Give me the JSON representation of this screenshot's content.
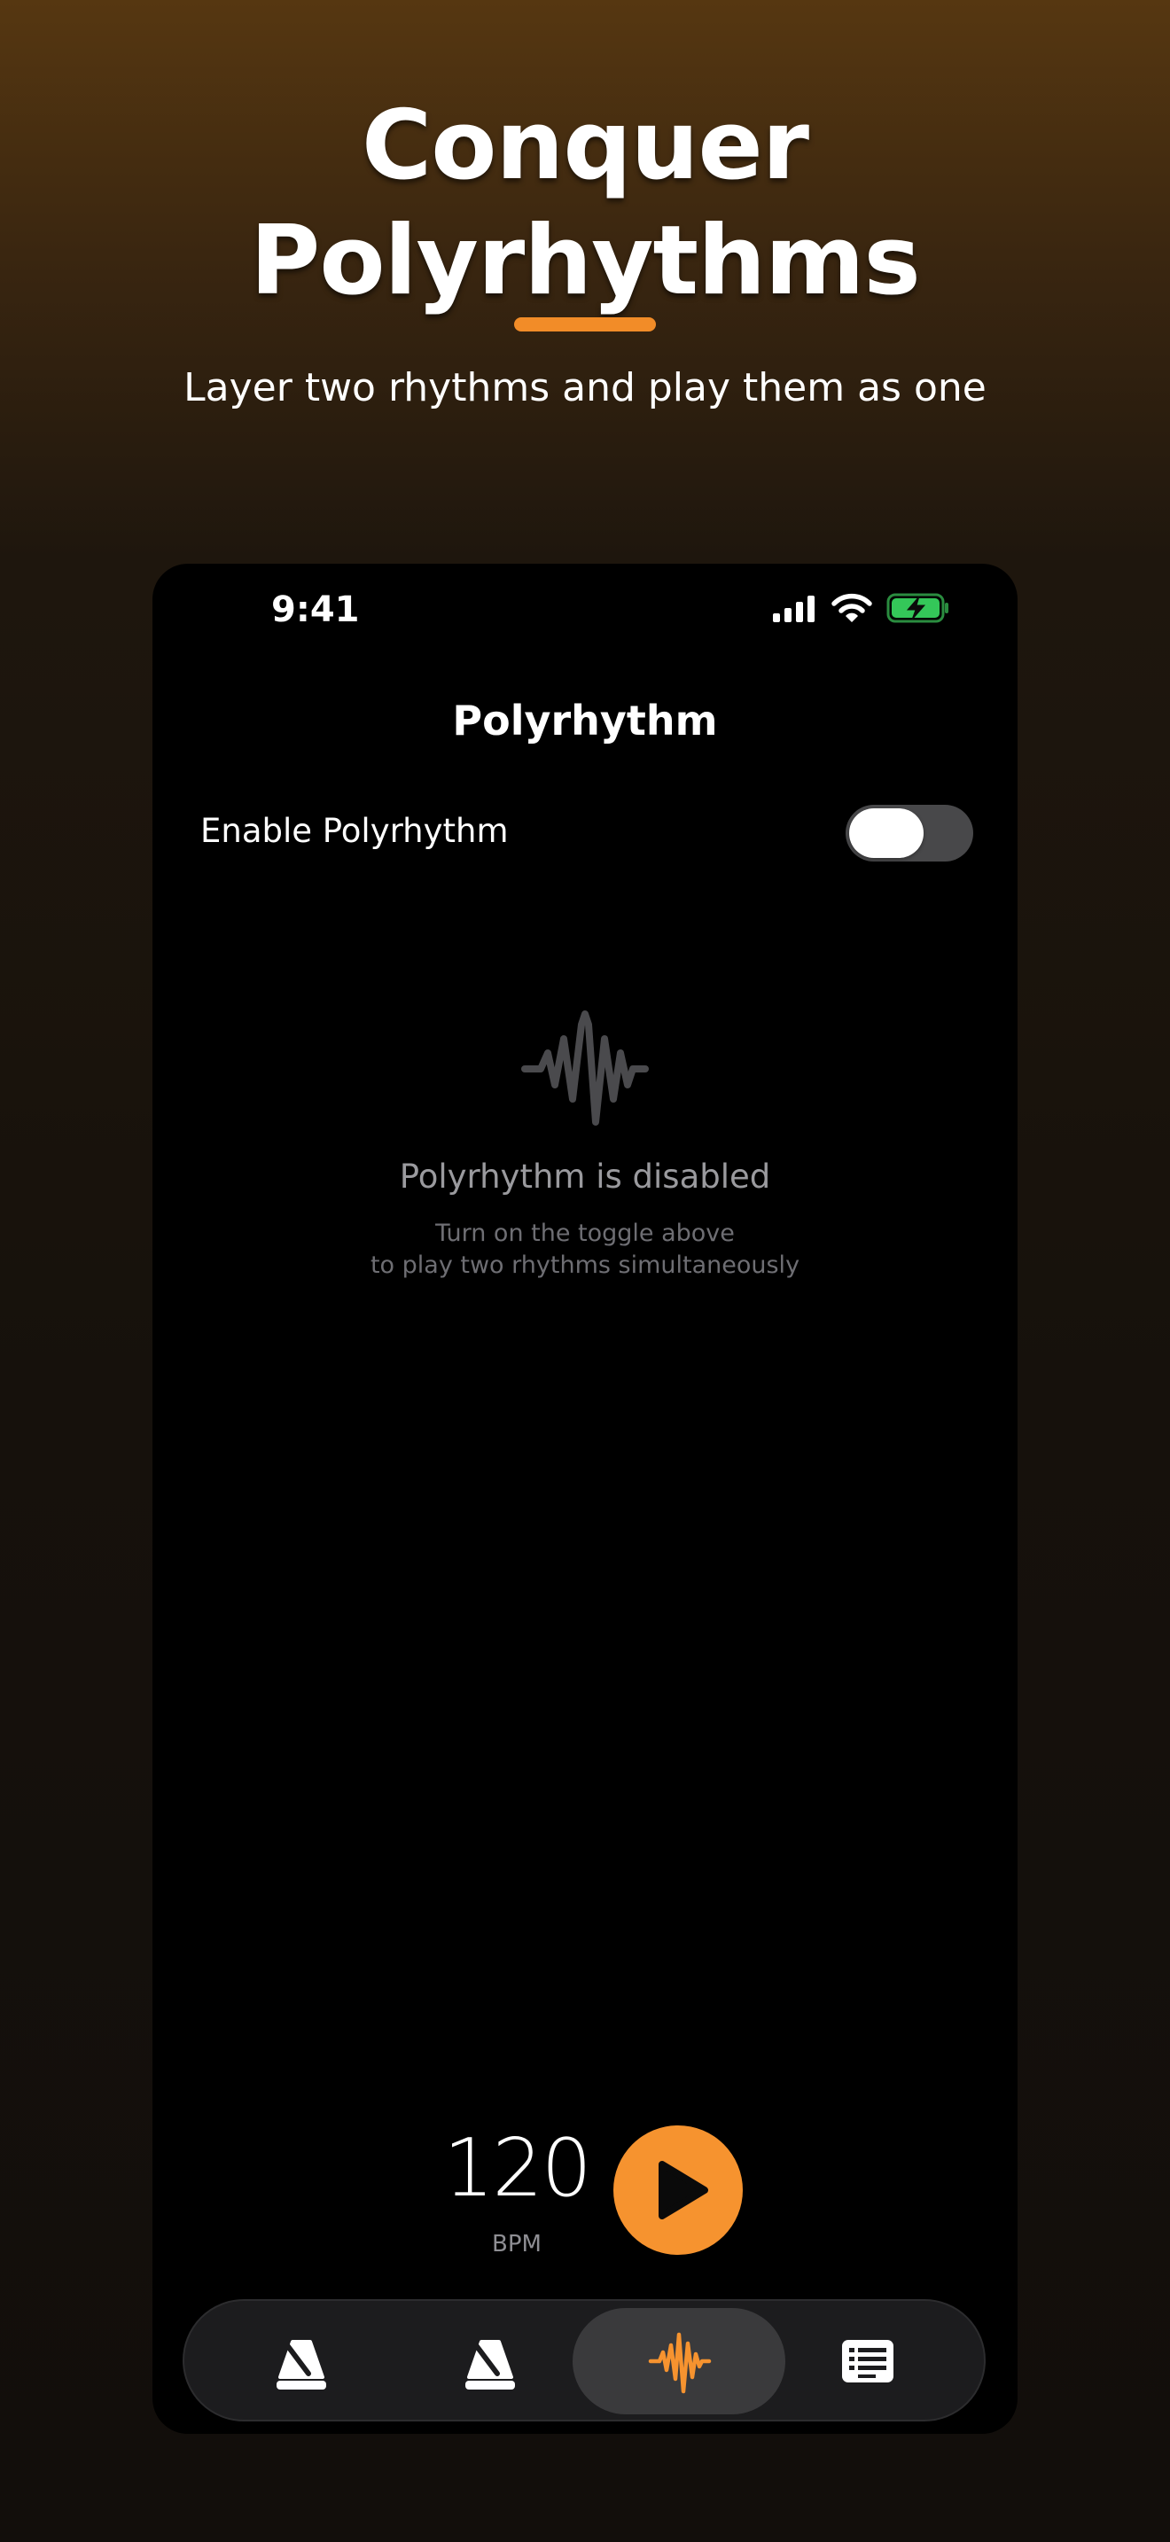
{
  "headline": {
    "line1": "Conquer",
    "line2": "Polyrhythms",
    "subtitle": "Layer two rhythms and play them as one",
    "accent_color": "#f28c28"
  },
  "status_bar": {
    "time": "9:41",
    "icons": [
      "cellular-signal-icon",
      "wifi-icon",
      "battery-charging-icon"
    ]
  },
  "screen": {
    "title": "Polyrhythm",
    "toggle_label": "Enable Polyrhythm",
    "toggle_on": false
  },
  "empty_state": {
    "icon": "waveform-icon",
    "title": "Polyrhythm is disabled",
    "line1": "Turn on the toggle above",
    "line2": "to play two rhythms simultaneously"
  },
  "transport": {
    "bpm_value": "120",
    "bpm_label": "BPM",
    "play_icon": "play-icon",
    "play_color": "#f6932f"
  },
  "tab_bar": {
    "tabs": [
      {
        "icon": "metronome-icon",
        "selected": false
      },
      {
        "icon": "metronome-icon",
        "selected": false
      },
      {
        "icon": "waveform-icon",
        "selected": true
      },
      {
        "icon": "list-icon",
        "selected": false
      }
    ],
    "selected_color": "#f6932f"
  }
}
